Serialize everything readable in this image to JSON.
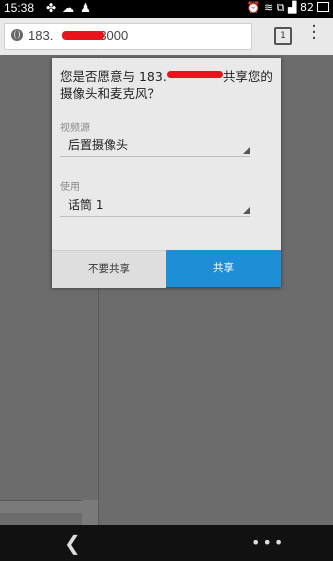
{
  "status_bar": {
    "time": "15:38",
    "icons": [
      "clover-icon",
      "cloud-icon",
      "qq-icon"
    ],
    "right_icons": [
      "alarm-icon",
      "wifi-icon",
      "screenshot-icon",
      "signal-icon"
    ],
    "battery": "82"
  },
  "browser": {
    "url_prefix": "183.",
    "url_suffix": "3000",
    "tab_count": "1"
  },
  "dialog": {
    "message_part1": "您是否愿意与 183.",
    "message_part2": "共享您的摄像头和麦克风？",
    "video_source_label": "视频源",
    "video_source_value": "后置摄像头",
    "use_label": "使用",
    "microphone_value": "话筒 1",
    "deny_button": "不要共享",
    "allow_button": "共享"
  },
  "colors": {
    "accent": "#1e8fd6",
    "redaction": "#e8131b"
  }
}
